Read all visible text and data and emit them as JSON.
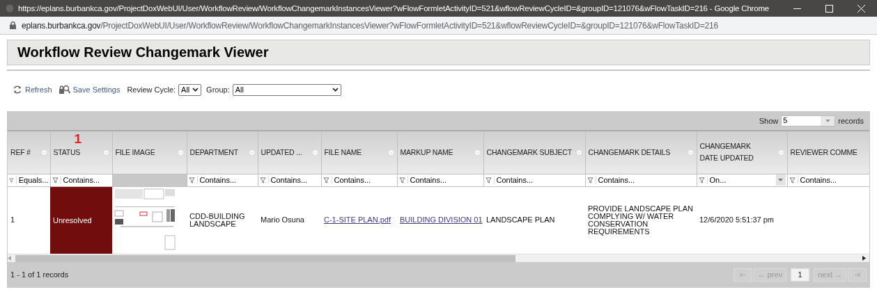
{
  "browser": {
    "title": "https://eplans.burbankca.gov/ProjectDoxWebUI/User/WorkflowReview/WorkflowChangemarkInstancesViewer?wFlowFormletActivityID=521&wflowReviewCycleID=&groupID=121076&wFlowTaskID=216 - Google Chrome",
    "url_host": "eplans.burbankca.gov",
    "url_path": "/ProjectDoxWebUI/User/WorkflowReview/WorkflowChangemarkInstancesViewer?wFlowFormletActivityID=521&wflowReviewCycleID=&groupID=121076&wFlowTaskID=216"
  },
  "page": {
    "title": "Workflow Review Changemark Viewer"
  },
  "toolbar": {
    "refresh": "Refresh",
    "save": "Save Settings",
    "review_cycle": {
      "label": "Review Cycle:",
      "value": "All"
    },
    "group": {
      "label": "Group:",
      "value": "All"
    }
  },
  "grid": {
    "show_label": "Show",
    "page_size": "5",
    "records_label": "records",
    "columns": [
      {
        "kind": "text",
        "header": "REF #",
        "filter": "Equals..."
      },
      {
        "kind": "text",
        "header": "STATUS",
        "filter": "Contains...",
        "annotation": "1"
      },
      {
        "header": "FILE IMAGE"
      },
      {
        "kind": "text",
        "header": "DEPARTMENT",
        "filter": "Contains..."
      },
      {
        "kind": "text",
        "header": "UPDATED ...",
        "filter": "Contains..."
      },
      {
        "kind": "text",
        "header": "FILE NAME",
        "filter": "Contains..."
      },
      {
        "kind": "text",
        "header": "MARKUP NAME",
        "filter": "Contains..."
      },
      {
        "kind": "text",
        "header": "CHANGEMARK SUBJECT",
        "filter": "Contains..."
      },
      {
        "kind": "text",
        "header": "CHANGEMARK DETAILS",
        "filter": "Contains..."
      },
      {
        "kind": "date",
        "header": "CHANGEMARK DATE UPDATED",
        "filter": "On..."
      },
      {
        "kind": "text",
        "header": "REVIEWER COMME",
        "filter": "Contains..."
      }
    ],
    "rows": [
      {
        "ref": "1",
        "status": {
          "text": "Unresolved",
          "color": "#720d0d"
        },
        "department": "CDD-BUILDING LANDSCAPE",
        "updated_by": "Mario Osuna",
        "file_name": "C-1-SITE PLAN.pdf",
        "markup_name": "BUILDING DIVISION 01",
        "subject": "LANDSCAPE PLAN",
        "details": "PROVIDE LANDSCAPE PLAN COMPLYING W/ WATER CONSERVATION REQUIREMENTS",
        "date_updated": "12/6/2020 5:51:37 pm"
      }
    ],
    "summary": "1 - 1 of 1 records",
    "pager": [
      {
        "kind": "first",
        "disabled": true
      },
      {
        "kind": "prev",
        "label": "← prev",
        "disabled": true
      },
      {
        "kind": "page",
        "label": "1",
        "selected": true
      },
      {
        "kind": "next",
        "label": "next →",
        "disabled": true
      },
      {
        "kind": "last",
        "disabled": true
      }
    ]
  }
}
